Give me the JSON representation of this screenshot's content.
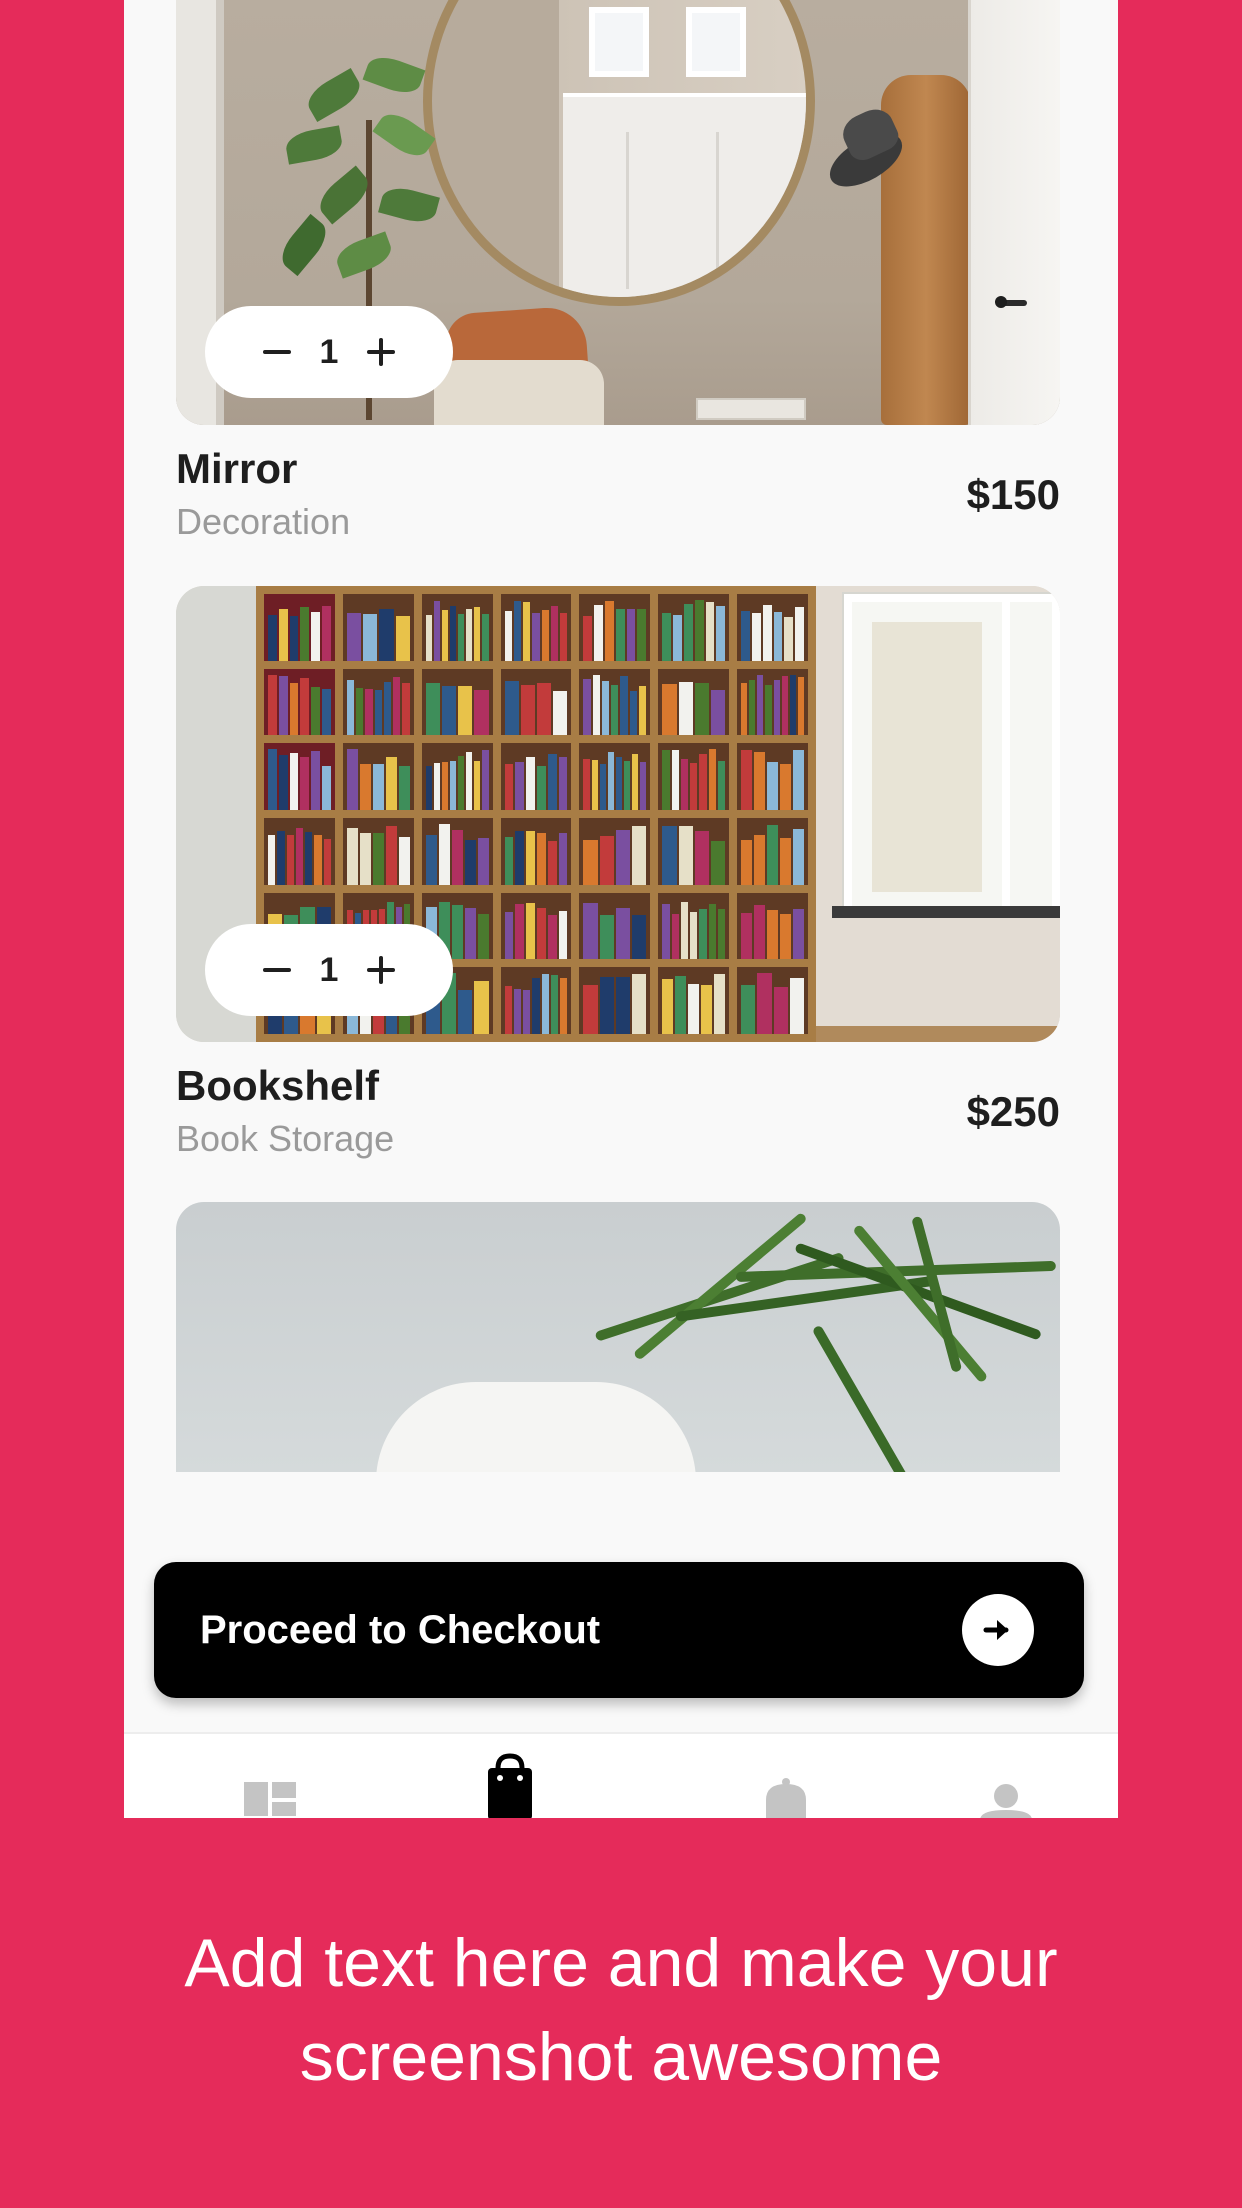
{
  "cart": {
    "items": [
      {
        "name": "Mirror",
        "category": "Decoration",
        "price": "$150",
        "quantity": "1",
        "image": "mirror-room-photo"
      },
      {
        "name": "Bookshelf",
        "category": "Book Storage",
        "price": "$250",
        "quantity": "1",
        "image": "bookshelf-room-photo"
      },
      {
        "image": "plant-chair-photo"
      }
    ]
  },
  "checkout": {
    "label": "Proceed to Checkout",
    "icon": "arrow-right-icon"
  },
  "nav": {
    "items": [
      {
        "icon": "dashboard-icon",
        "active": false
      },
      {
        "icon": "shopping-bag-icon",
        "active": true
      },
      {
        "icon": "bell-icon",
        "active": false
      },
      {
        "icon": "person-icon",
        "active": false
      }
    ]
  },
  "caption": {
    "line1": "Add text here and make your",
    "line2": "screenshot awesome"
  },
  "colors": {
    "background": "#E52B5A",
    "surface": "#F9F9F9",
    "button": "#000000",
    "text_primary": "#1E1E1E",
    "text_secondary": "#9A9A9A"
  }
}
